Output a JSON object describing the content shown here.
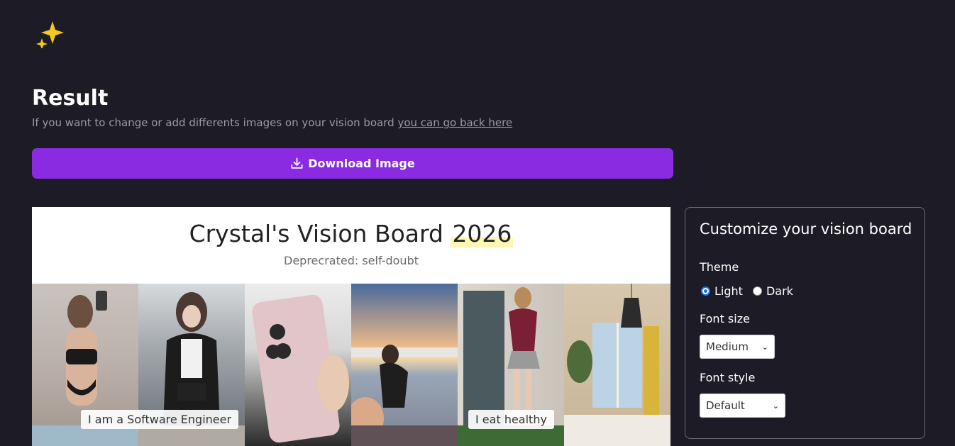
{
  "header": {
    "logo_icon": "sparkles-icon",
    "title": "Result",
    "subtitle_text": "If you want to change or add differents images on your vision board ",
    "subtitle_link": "you can go back here"
  },
  "download": {
    "label": "Download Image",
    "icon": "download-icon"
  },
  "board": {
    "title_main": "Crystal's Vision Board ",
    "title_year": "2026",
    "subtitle": "Deprecrated: self-doubt",
    "captions": [
      "I am a Software Engineer",
      "I eat healthy"
    ]
  },
  "panel": {
    "title": "Customize your vision board",
    "theme_label": "Theme",
    "theme_options": [
      "Light",
      "Dark"
    ],
    "theme_selected": "Light",
    "font_size_label": "Font size",
    "font_size_value": "Medium",
    "font_style_label": "Font style",
    "font_style_value": "Default"
  },
  "colors": {
    "background": "#1d1b26",
    "accent": "#8a2be2",
    "logo": "#f2c91c"
  }
}
